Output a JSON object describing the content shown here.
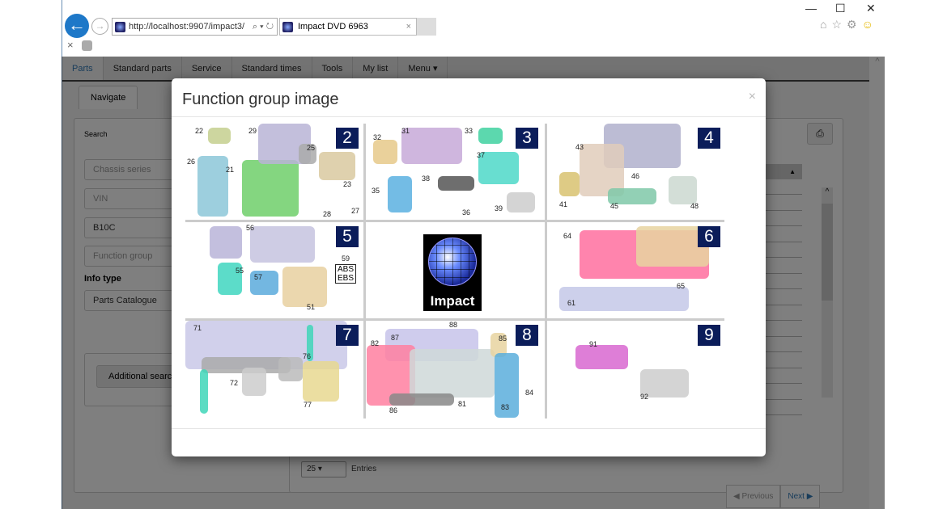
{
  "browser": {
    "url": "http://localhost:9907/impact3/",
    "url_host": "localhost",
    "tab_title": "Impact DVD 6963",
    "window_controls": [
      "—",
      "☐",
      "✕"
    ]
  },
  "nav": {
    "tabs": [
      "Parts",
      "Standard parts",
      "Service",
      "Standard times",
      "Tools",
      "My list",
      "Menu ▾"
    ],
    "active": "Parts"
  },
  "subtab": "Navigate",
  "search_panel": {
    "title": "Search",
    "fields": [
      {
        "placeholder": "Chassis series",
        "value": ""
      },
      {
        "placeholder": "VIN",
        "value": ""
      },
      {
        "placeholder": "",
        "value": "B10C"
      },
      {
        "placeholder": "Function group",
        "value": ""
      }
    ],
    "info_type_label": "Info type",
    "info_type_value": "Parts Catalogue",
    "additional_search_label": "Additional search"
  },
  "results": {
    "page_size": "25",
    "entries_label": "Entries",
    "previous_label": "Previous",
    "next_label": "Next"
  },
  "modal": {
    "title": "Function group image",
    "close": "×",
    "cells": [
      {
        "group": "2",
        "parts": [
          "22",
          "29",
          "26",
          "21",
          "25",
          "23",
          "28",
          "27"
        ]
      },
      {
        "group": "3",
        "parts": [
          "31",
          "33",
          "32",
          "37",
          "38",
          "35",
          "36",
          "39"
        ]
      },
      {
        "group": "4",
        "parts": [
          "43",
          "46",
          "41",
          "45",
          "48"
        ]
      },
      {
        "group": "5",
        "parts": [
          "56",
          "55",
          "57",
          "59",
          "51"
        ],
        "note": [
          "ABS",
          "EBS"
        ]
      },
      {
        "logo": "Impact"
      },
      {
        "group": "6",
        "parts": [
          "64",
          "65",
          "61"
        ]
      },
      {
        "group": "7",
        "parts": [
          "71",
          "76",
          "72",
          "77"
        ]
      },
      {
        "group": "8",
        "parts": [
          "88",
          "87",
          "85",
          "82",
          "81",
          "84",
          "86",
          "83"
        ]
      },
      {
        "group": "9",
        "parts": [
          "91",
          "92"
        ]
      }
    ]
  },
  "colors": {
    "badge": "#0b1d5a",
    "back_button": "#1e78c8",
    "link": "#337ab7"
  }
}
